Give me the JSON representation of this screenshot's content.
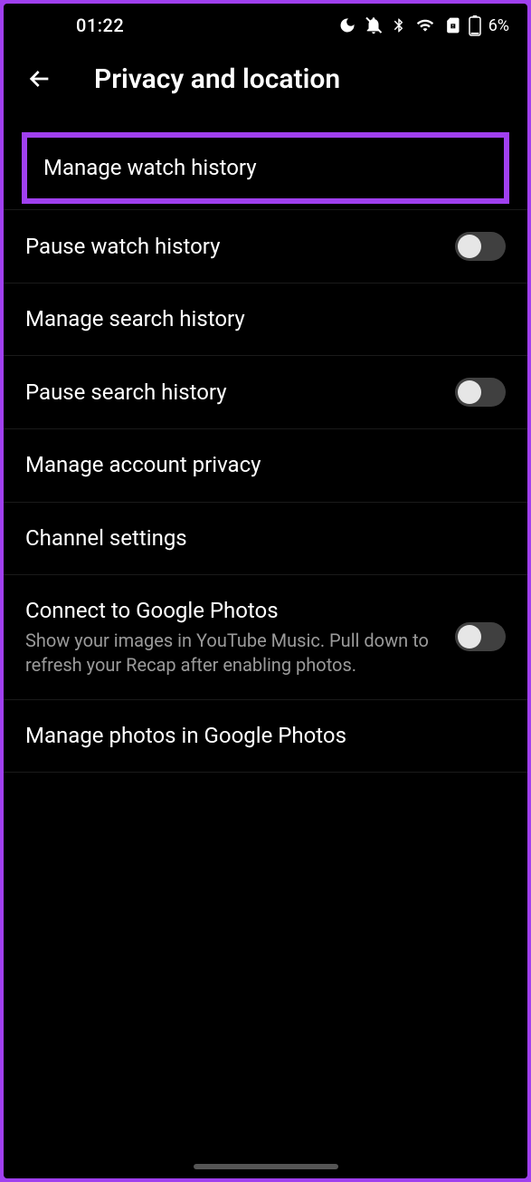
{
  "status": {
    "time": "01:22",
    "battery": "6%"
  },
  "header": {
    "title": "Privacy and location"
  },
  "items": {
    "manage_watch_history": "Manage watch history",
    "pause_watch_history": "Pause watch history",
    "manage_search_history": "Manage search history",
    "pause_search_history": "Pause search history",
    "manage_account_privacy": "Manage account privacy",
    "channel_settings": "Channel settings",
    "connect_google_photos": {
      "title": "Connect to Google Photos",
      "sub": "Show your images in YouTube Music. Pull down to refresh your Recap after enabling photos."
    },
    "manage_photos": "Manage photos in Google Photos"
  }
}
